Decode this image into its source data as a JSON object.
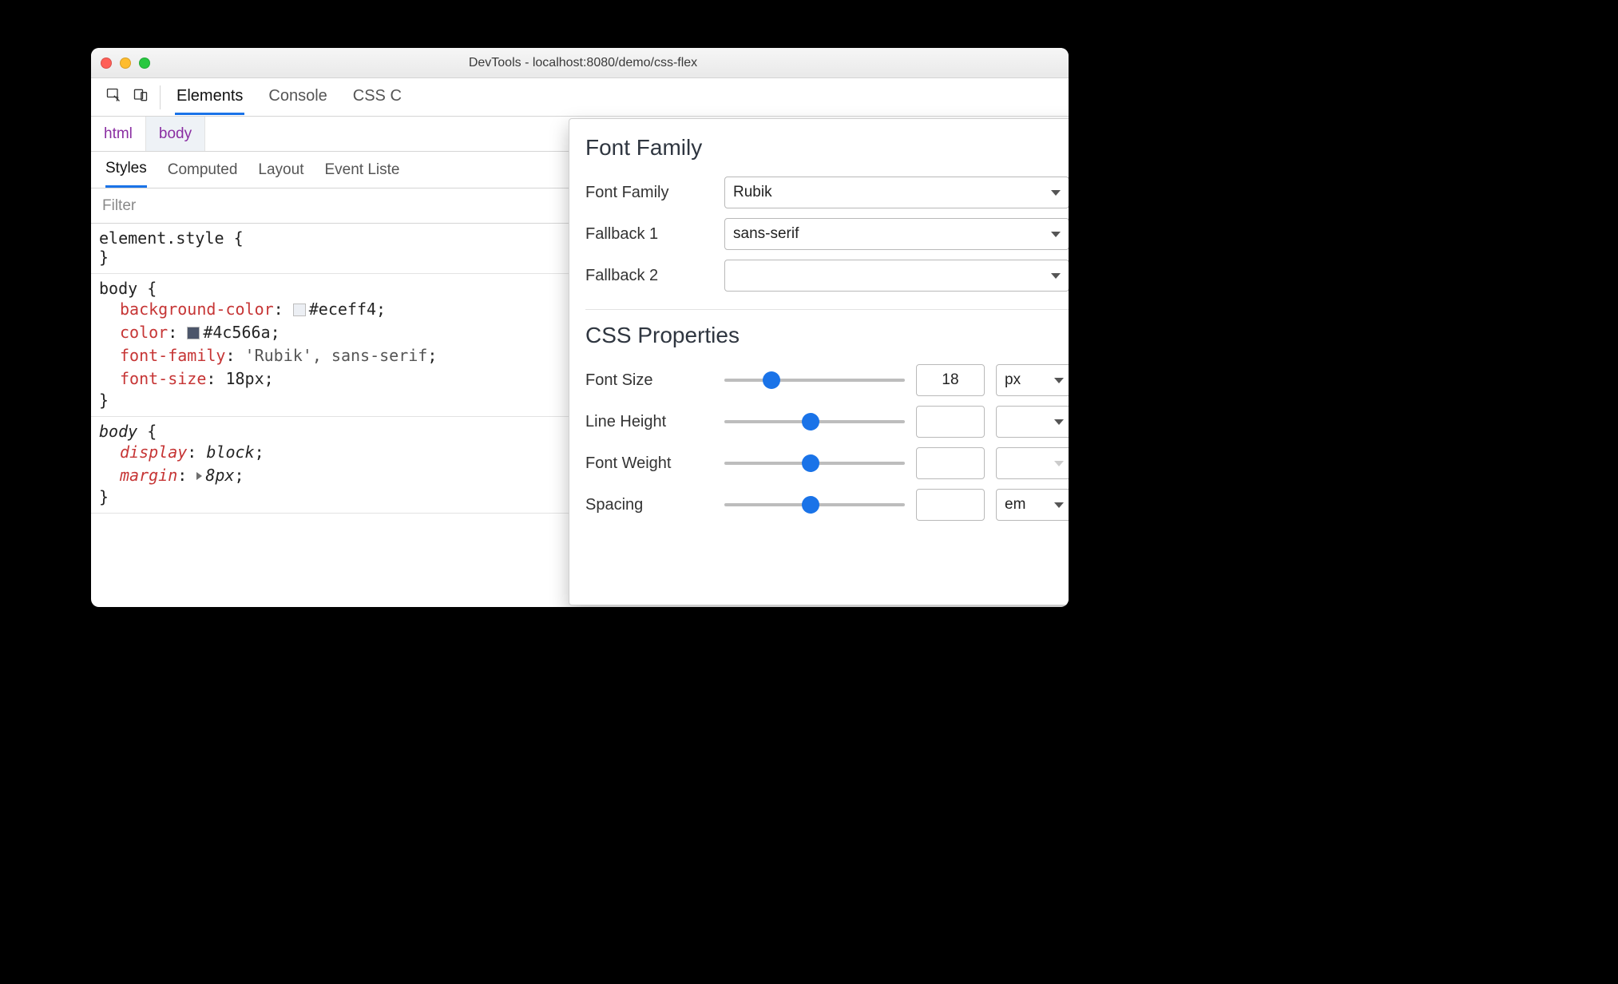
{
  "window": {
    "title": "DevTools - localhost:8080/demo/css-flex"
  },
  "toolbar": {
    "tabs": {
      "elements": "Elements",
      "console": "Console",
      "css": "CSS C"
    },
    "active": "elements"
  },
  "breadcrumbs": {
    "items": [
      "html",
      "body"
    ],
    "selected": 1
  },
  "subtabs": {
    "styles": "Styles",
    "computed": "Computed",
    "layout": "Layout",
    "listeners": "Event Liste",
    "active": "styles"
  },
  "filter": {
    "placeholder": "Filter"
  },
  "styles_panel": {
    "element_style": {
      "selector": "element.style",
      "open": " {",
      "close": "}"
    },
    "rule_body_1": {
      "selector": "body",
      "open": " {",
      "close": "}",
      "decls": [
        {
          "prop": "background-color",
          "value": "#eceff4",
          "swatch": "#eceff4"
        },
        {
          "prop": "color",
          "value": "#4c566a",
          "swatch": "#4c566a"
        },
        {
          "prop": "font-family",
          "value": "'Rubik', sans-serif"
        },
        {
          "prop": "font-size",
          "value": "18px"
        }
      ]
    },
    "rule_body_2": {
      "selector": "body",
      "open": " {",
      "close": "}",
      "italic": true,
      "decls": [
        {
          "prop": "display",
          "value": "block"
        },
        {
          "prop": "margin",
          "value": "8px",
          "expand": true
        }
      ]
    }
  },
  "panel": {
    "font_family_section": {
      "title": "Font Family",
      "rows": [
        {
          "label": "Font Family",
          "value": "Rubik"
        },
        {
          "label": "Fallback 1",
          "value": "sans-serif"
        },
        {
          "label": "Fallback 2",
          "value": ""
        }
      ]
    },
    "css_properties_section": {
      "title": "CSS Properties",
      "rows": [
        {
          "label": "Font Size",
          "slider_pct": 26,
          "value": "18",
          "unit": "px"
        },
        {
          "label": "Line Height",
          "slider_pct": 48,
          "value": "",
          "unit": ""
        },
        {
          "label": "Font Weight",
          "slider_pct": 48,
          "value": "",
          "unit": "",
          "unit_disabled": true
        },
        {
          "label": "Spacing",
          "slider_pct": 48,
          "value": "",
          "unit": "em"
        }
      ]
    }
  }
}
